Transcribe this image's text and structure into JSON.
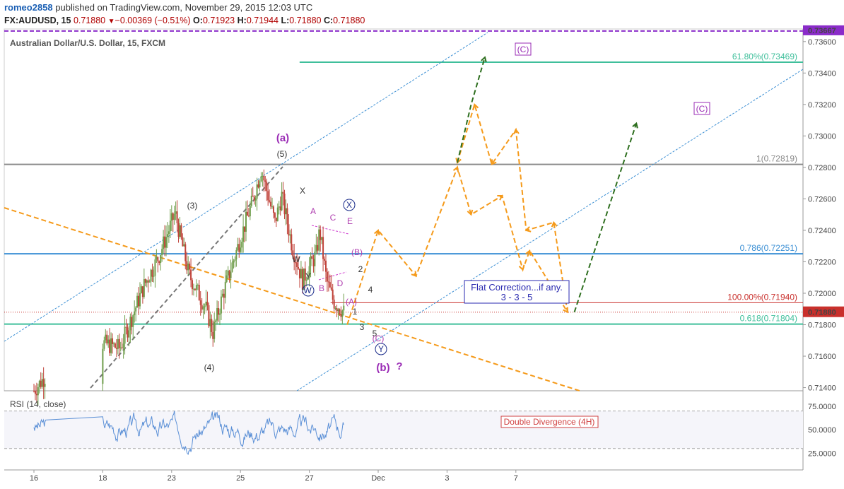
{
  "header": {
    "user": "romeo2858",
    "published": "published on TradingView.com, November 29, 2015 12:03 UTC",
    "symbol_line": "FX:AUDUSD, 15",
    "last": "0.71880",
    "change_arrow": "▼",
    "change": "−0.00369 (−0.51%)",
    "o_label": "O:",
    "o_value": "0.71923",
    "h_label": "H:",
    "h_value": "0.71944",
    "l_label": "L:",
    "l_value": "0.71880",
    "c_label": "C:",
    "c_value": "0.71880"
  },
  "colors": {
    "up": "#6f9d4b",
    "down": "#c0433a",
    "orange": "#f59a1a",
    "green_proj": "#2d6e1e",
    "teal": "#3fbf9b",
    "blue_h": "#3b8fd4",
    "grey_h": "#8a8a8a",
    "red_h": "#c9302c",
    "purple": "#8a2bc9",
    "rsi": "#5a8fd6"
  },
  "chart_data": {
    "type": "line",
    "title": "Australian Dollar/U.S. Dollar, 15, FXCM",
    "ylim": [
      0.7138,
      0.7368
    ],
    "price_ticks": [
      "0.73600",
      "0.73400",
      "0.73200",
      "0.73000",
      "0.72800",
      "0.72600",
      "0.72400",
      "0.72200",
      "0.72000",
      "0.71800",
      "0.71600",
      "0.71400"
    ],
    "price_tick_values": [
      0.736,
      0.734,
      0.732,
      0.73,
      0.728,
      0.726,
      0.724,
      0.722,
      0.72,
      0.718,
      0.716,
      0.714
    ],
    "date_ticks": [
      "16",
      "18",
      "23",
      "25",
      "27",
      "Dec",
      "3",
      "7"
    ],
    "date_tick_x": [
      0.0,
      2.0,
      4.0,
      6.0,
      8.0,
      10.0,
      12.0,
      14.0
    ],
    "current_price_label": "0.71880",
    "current_price": 0.7188,
    "top_price_label": "0.73667",
    "top_price": 0.73667,
    "price_series_summary": [
      [
        0.0,
        0.7138
      ],
      [
        0.5,
        0.7152
      ],
      [
        1.0,
        0.7175
      ],
      [
        2.5,
        0.7165
      ],
      [
        3.2,
        0.7205
      ],
      [
        3.6,
        0.7222
      ],
      [
        4.0,
        0.7245
      ],
      [
        4.1,
        0.7251
      ],
      [
        4.5,
        0.7212
      ],
      [
        5.0,
        0.719
      ],
      [
        5.2,
        0.7175
      ],
      [
        5.5,
        0.72
      ],
      [
        6.0,
        0.7235
      ],
      [
        6.4,
        0.7262
      ],
      [
        6.6,
        0.7279
      ],
      [
        7.0,
        0.7245
      ],
      [
        7.2,
        0.7262
      ],
      [
        7.5,
        0.723
      ],
      [
        7.8,
        0.7208
      ],
      [
        8.2,
        0.7225
      ],
      [
        8.3,
        0.724
      ],
      [
        8.5,
        0.7208
      ],
      [
        8.7,
        0.7195
      ],
      [
        9.0,
        0.7188
      ]
    ],
    "horizontal_levels": [
      {
        "label": "61.80%(0.73469)",
        "value": 0.73469,
        "color": "teal",
        "x_start": 7.8
      },
      {
        "label": "1(0.72819)",
        "value": 0.72819,
        "color": "grey",
        "x_start": 0
      },
      {
        "label": "0.786(0.72251)",
        "value": 0.72251,
        "color": "blue",
        "x_start": 0
      },
      {
        "label": "100.00%(0.71940)",
        "value": 0.7194,
        "color": "red",
        "x_start": 8.7
      },
      {
        "label": "0.618(0.71804)",
        "value": 0.71804,
        "color": "teal",
        "x_start": 0
      }
    ],
    "orange_projection": [
      [
        9.1,
        0.718
      ],
      [
        10.0,
        0.724
      ],
      [
        11.1,
        0.7211
      ],
      [
        12.3,
        0.728
      ],
      [
        12.7,
        0.725
      ],
      [
        13.6,
        0.7262
      ],
      [
        14.2,
        0.7215
      ],
      [
        14.4,
        0.7227
      ],
      [
        15.5,
        0.7188
      ],
      [
        15.1,
        0.7245
      ],
      [
        14.3,
        0.724
      ],
      [
        14.0,
        0.7304
      ],
      [
        13.3,
        0.7282
      ],
      [
        12.8,
        0.732
      ],
      [
        12.3,
        0.7283
      ]
    ],
    "green_projections": [
      [
        [
          12.3,
          0.7283
        ],
        [
          12.7,
          0.732
        ],
        [
          13.1,
          0.735
        ]
      ],
      [
        [
          15.7,
          0.7188
        ],
        [
          17.5,
          0.7308
        ]
      ]
    ],
    "wave_labels": [
      "(a)",
      "(5)",
      "(3)",
      "(4)",
      "X",
      "W",
      "Y",
      "A",
      "B",
      "C",
      "D",
      "E",
      "(B)",
      "2",
      "4",
      "(A)",
      "1",
      "3",
      "5",
      "(C)",
      "Y",
      "X",
      "W",
      "(b)",
      "?",
      "(C)",
      "(C)"
    ],
    "annotation_box": {
      "line1": "Flat Correction...if any.",
      "line2": "3 - 3 - 5"
    },
    "rsi": {
      "title": "RSI (14, close)",
      "ticks": [
        "75.0000",
        "50.0000",
        "25.0000"
      ],
      "tick_values": [
        75,
        50,
        25
      ],
      "ylim": [
        8,
        90
      ],
      "annotation": "Double Divergence (4H)"
    }
  }
}
